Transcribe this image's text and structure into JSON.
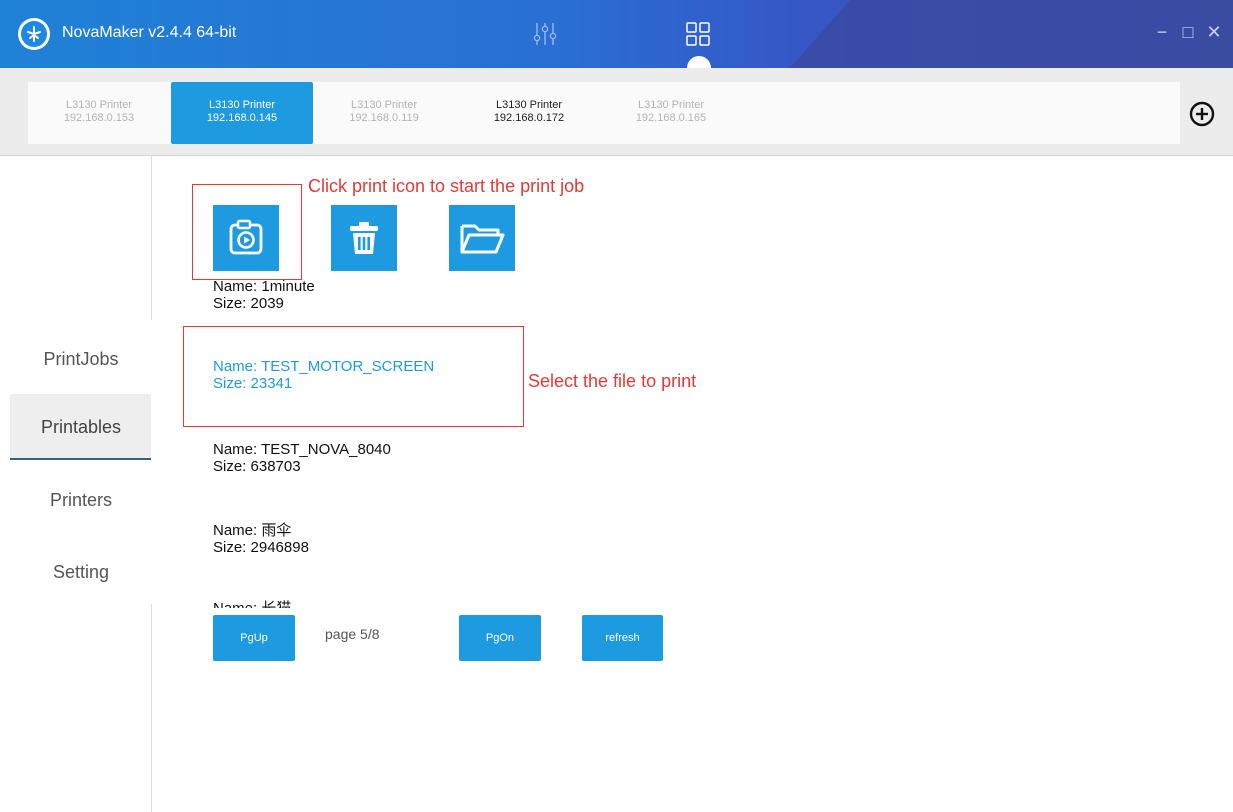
{
  "window": {
    "title": "NovaMaker v2.4.4 64-bit",
    "controls": {
      "minimize": "−",
      "maximize": "□",
      "close": "✕"
    }
  },
  "printers": [
    {
      "name": "L3130 Printer",
      "ip": "192.168.0.153",
      "state": "inactive"
    },
    {
      "name": "L3130 Printer",
      "ip": "192.168.0.145",
      "state": "active"
    },
    {
      "name": "L3130 Printer",
      "ip": "192.168.0.119",
      "state": "inactive"
    },
    {
      "name": "L3130 Printer",
      "ip": "192.168.0.172",
      "state": "connected"
    },
    {
      "name": "L3130 Printer",
      "ip": "192.168.0.165",
      "state": "inactive"
    }
  ],
  "sidebar": {
    "items": [
      {
        "label": "PrintJobs"
      },
      {
        "label": "Printables",
        "active": true
      },
      {
        "label": "Printers"
      },
      {
        "label": "Setting"
      }
    ]
  },
  "toolbar": {
    "icons": [
      "print-icon",
      "trash-icon",
      "folder-icon"
    ]
  },
  "files": [
    {
      "name": "Name: 1minute",
      "size": "Size: 2039"
    },
    {
      "name": "Name: TEST_MOTOR_SCREEN",
      "size": "Size: 23341",
      "selected": true
    },
    {
      "name": "Name: TEST_NOVA_8040",
      "size": "Size: 638703"
    },
    {
      "name": "Name: 雨伞",
      "size": "Size: 2946898"
    },
    {
      "name": "Name: 长猫",
      "size": ""
    }
  ],
  "pager": {
    "prev_label": "PgUp",
    "page_text": "page 5/8",
    "next_label": "PgOn",
    "refresh_label": "refresh"
  },
  "annotations": {
    "print_hint": "Click print icon to start the print job",
    "select_hint": "Select the file to print"
  },
  "colors": {
    "accent": "#1e9ae0",
    "titlebar": "#2a6fd4",
    "annotation": "#e53935",
    "selected_text": "#1e9ae0"
  }
}
